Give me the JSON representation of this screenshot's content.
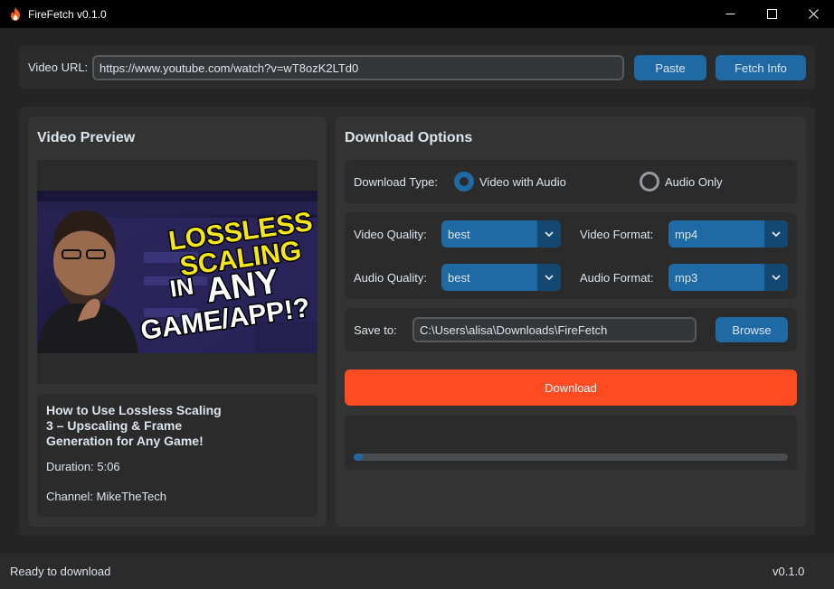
{
  "window": {
    "title": "FireFetch v0.1.0",
    "icon": "fire-icon",
    "controls": [
      "minimize-icon",
      "maximize-icon",
      "close-icon"
    ]
  },
  "url_bar": {
    "label": "Video URL:",
    "value": "https://www.youtube.com/watch?v=wT8ozK2LTd0",
    "paste_label": "Paste",
    "fetch_label": "Fetch Info"
  },
  "preview": {
    "heading": "Video Preview",
    "thumbnail_text": [
      "LOSSLESS",
      "SCALING",
      "IN",
      "ANY",
      "GAME/APP!?"
    ],
    "video_title": "How to Use Lossless Scaling 3 – Upscaling & Frame Generation for Any Game!",
    "duration": "Duration: 5:06",
    "channel": "Channel: MikeTheTech"
  },
  "options": {
    "heading": "Download Options",
    "download_type_label": "Download Type:",
    "type_options": [
      {
        "label": "Video with Audio",
        "selected": true
      },
      {
        "label": "Audio Only",
        "selected": false
      }
    ],
    "video_quality_label": "Video Quality:",
    "video_quality_value": "best",
    "video_format_label": "Video Format:",
    "video_format_value": "mp4",
    "audio_quality_label": "Audio Quality:",
    "audio_quality_value": "best",
    "audio_format_label": "Audio Format:",
    "audio_format_value": "mp3",
    "save_label": "Save to:",
    "save_path": "C:\\Users\\alisa\\Downloads\\FireFetch",
    "browse_label": "Browse",
    "download_label": "Download",
    "progress": 0.02
  },
  "status": {
    "text": "Ready to download",
    "version": "v0.1.0"
  },
  "colors": {
    "accent": "#1f6aa5",
    "download": "#ff4b22",
    "background": "#242424"
  }
}
